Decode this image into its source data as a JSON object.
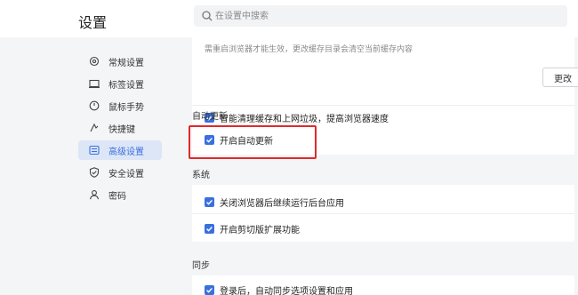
{
  "header": {
    "title": "设置",
    "search_placeholder": "在设置中搜索"
  },
  "sidebar": {
    "items": [
      {
        "label": "常规设置",
        "icon": "gear-icon",
        "active": false
      },
      {
        "label": "标签设置",
        "icon": "tab-icon",
        "active": false
      },
      {
        "label": "鼠标手势",
        "icon": "mouse-icon",
        "active": false
      },
      {
        "label": "快捷键",
        "icon": "keyboard-icon",
        "active": false
      },
      {
        "label": "高级设置",
        "icon": "advanced-icon",
        "active": true
      },
      {
        "label": "安全设置",
        "icon": "shield-icon",
        "active": false
      },
      {
        "label": "密码",
        "icon": "user-icon",
        "active": false
      }
    ]
  },
  "main": {
    "cache": {
      "hint": "需重启浏览器才能生效，更改缓存目录会清空当前缓存内容",
      "change_button": "更改",
      "smart_clean_label": "智能清理缓存和上网垃圾，提高浏览器速度"
    },
    "auto_update": {
      "title": "自动更新",
      "enable_label": "开启自动更新"
    },
    "system": {
      "title": "系统",
      "background_label": "关闭浏览器后继续运行后台应用",
      "clipboard_label": "开启剪切版扩展功能"
    },
    "sync": {
      "title": "同步",
      "login_sync_label": "登录后，自动同步选项设置和应用"
    }
  },
  "colors": {
    "accent": "#3a6fe0",
    "highlight_border": "#e02a2a",
    "active_nav_bg": "#dde6f7"
  }
}
